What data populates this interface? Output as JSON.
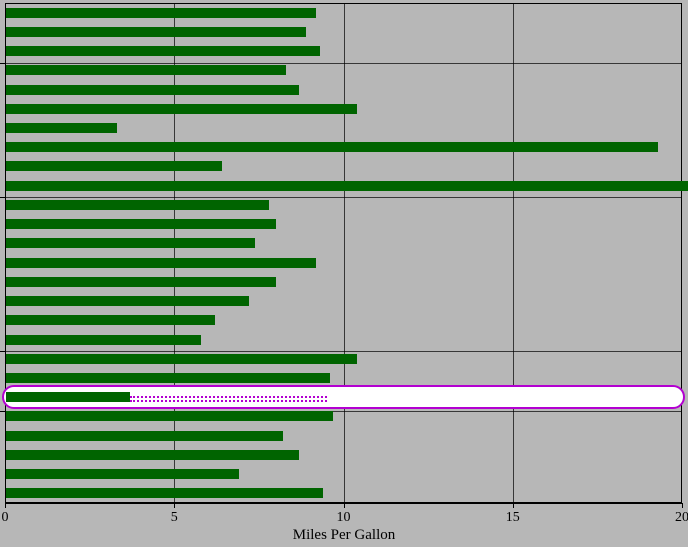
{
  "chart_data": {
    "type": "bar",
    "orientation": "horizontal",
    "xlabel": "Miles Per Gallon",
    "ylabel": "",
    "title": "",
    "xlim": [
      0,
      20
    ],
    "xticks": [
      0,
      5,
      10,
      15,
      20
    ],
    "values": [
      9.2,
      8.9,
      9.3,
      8.3,
      8.7,
      10.4,
      3.3,
      19.3,
      6.4,
      20.7,
      7.8,
      8.0,
      7.4,
      9.2,
      8.0,
      7.2,
      6.2,
      5.8,
      10.4,
      9.6,
      3.7,
      9.7,
      8.2,
      8.7,
      6.9,
      9.4
    ],
    "highlighted_index": 20,
    "highlight": {
      "actual_value": 3.7,
      "target_value": 9.5
    }
  },
  "axis": {
    "tick_labels": [
      "0",
      "5",
      "10",
      "15",
      "20"
    ],
    "xlabel": "Miles Per Gallon"
  }
}
